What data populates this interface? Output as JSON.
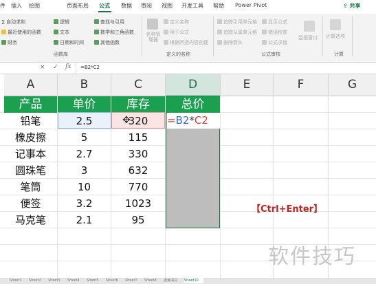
{
  "menu": {
    "items": [
      "公式",
      "数据",
      "审阅",
      "视图",
      "开发工具",
      "帮助",
      "Power Pivot"
    ],
    "partial_items": [
      "件",
      "插入",
      "绘图",
      "页面布局"
    ],
    "active": "公式",
    "share": "共享"
  },
  "ribbon": {
    "groups": {
      "function_library": "函数库",
      "defined_names": "定义的名称",
      "formula_auditing": "公式审核",
      "calculation": "计算"
    },
    "buttons": {
      "autosum": "自动求和",
      "recent": "最近使用的函数",
      "financial": "财务",
      "logical": "逻辑",
      "text": "文本",
      "datetime": "日期和时间",
      "lookup": "查找与引用",
      "math": "数学和三角函数",
      "more": "其他函数",
      "name_manager": "名称管理器",
      "define_name": "定义名称",
      "use_in_formula": "用于公式",
      "create_from_selection": "根据所选内容创建",
      "trace_precedents": "追踪引用单元格",
      "trace_dependents": "追踪从属单元格",
      "remove_arrows": "删除箭头",
      "show_formulas": "显示公式",
      "error_checking": "错误检查",
      "evaluate_formula": "公式求值",
      "watch_window": "监视窗口",
      "calc_options": "计算选项"
    }
  },
  "formula_bar": {
    "cancel": "×",
    "enter": "✓",
    "fx": "fx",
    "formula": "=B2*C2"
  },
  "columns": [
    "A",
    "B",
    "C",
    "D",
    "E",
    "F",
    "G"
  ],
  "table": {
    "headers": [
      "产品",
      "单价",
      "库存",
      "总价"
    ],
    "rows": [
      [
        "铅笔",
        "2.5",
        "320"
      ],
      [
        "橡皮擦",
        "5",
        "115"
      ],
      [
        "记事本",
        "2.7",
        "330"
      ],
      [
        "圆珠笔",
        "3",
        "632"
      ],
      [
        "笔筒",
        "10",
        "770"
      ],
      [
        "便签",
        "3.2",
        "1023"
      ],
      [
        "马克笔",
        "2.1",
        "95"
      ]
    ]
  },
  "editing_formula": {
    "eq": "=",
    "ref1": "B2",
    "op": "*",
    "ref2": "C2"
  },
  "annotation": "【Ctrl+Enter】",
  "watermark": "软件技巧",
  "sheet_tabs": [
    "Sheet1",
    "Sheet2",
    "Sheet3",
    "Sheet4",
    "Sheet5",
    "Sheet6",
    "Sheet7",
    "Sheet8",
    "批量填充",
    "Sheet10"
  ],
  "colors": {
    "accent": "#1e7145",
    "header_fill": "#1aa04f",
    "annotation": "#c0221f",
    "ref1": "#2f6fd6",
    "ref2": "#d0453b"
  }
}
